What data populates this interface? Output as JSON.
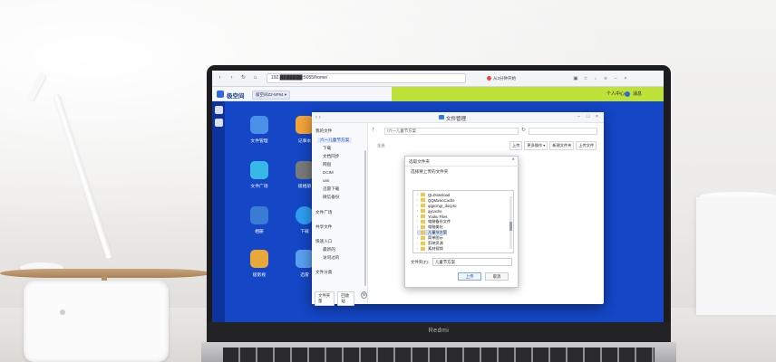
{
  "browser": {
    "url": "192.███████:5055/home/",
    "search_hint": "从3分钟开始",
    "nav_icons": [
      "back-icon",
      "forward-icon",
      "refresh-icon",
      "home-icon"
    ]
  },
  "app": {
    "name": "极空间",
    "device_tag": "极空间Z2-5F94 ▾",
    "header_right": [
      "个人中心",
      "消息"
    ],
    "accent_color": "#bfe23a",
    "brand_color": "#2d6be0"
  },
  "desktop": {
    "icons": [
      {
        "label": "文件管理",
        "color": "#4a8fe8"
      },
      {
        "label": "记事本",
        "color": "#f2a33a"
      },
      {
        "label": "文件广场",
        "color": "#38b8e8"
      },
      {
        "label": "极相册",
        "color": "#7a7a7a"
      },
      {
        "label": "相册",
        "color": "#3a7bd5"
      },
      {
        "label": "下载",
        "color": "#2f9df0"
      },
      {
        "label": "极影视",
        "color": "#e8a93a"
      },
      {
        "label": "迅雷",
        "color": "#5aa0f0"
      }
    ]
  },
  "file_manager": {
    "title": "文件管理",
    "sidebar": {
      "groups": [
        {
          "label": "我的文件"
        },
        {
          "label": "六一儿童节方案",
          "selected": true
        },
        {
          "label": "下载"
        },
        {
          "label": "文档同步"
        },
        {
          "label": "网盘"
        },
        {
          "label": "DCIM"
        },
        {
          "label": "umi"
        },
        {
          "label": "迅雷下载"
        },
        {
          "label": "微信备份"
        },
        {
          "label": "文件广场"
        },
        {
          "label": "共享文件"
        },
        {
          "label": "快速入口"
        },
        {
          "label": "最新的"
        },
        {
          "label": "访问过的"
        },
        {
          "label": "文件分类"
        }
      ],
      "bottom_buttons": [
        "文件夹量",
        "回收站"
      ]
    },
    "path": "/六一儿童节方案",
    "toolbar": {
      "select_all": "全选",
      "buttons": [
        "上传",
        "更多操作 ▾",
        "新建文件夹",
        "上传文件"
      ]
    }
  },
  "dialog": {
    "title": "选取文件夹",
    "prompt": "选择要上传的文件夹",
    "tree": [
      {
        "label": "QLDownload"
      },
      {
        "label": "QQMusicCache"
      },
      {
        "label": "qqpcmgr_docpro"
      },
      {
        "label": "qycache"
      },
      {
        "label": "Youku Files"
      },
      {
        "label": "电脑备份文件"
      },
      {
        "label": "电脑美化"
      },
      {
        "label": "儿童节方案",
        "selected": true
      },
      {
        "label": "简单图示"
      },
      {
        "label": "剪映资源"
      },
      {
        "label": "素材视频"
      }
    ],
    "name_label": "文件夹(F):",
    "name_value": "儿童节方案",
    "ok_label": "上传",
    "cancel_label": "取消"
  },
  "laptop": {
    "brand": "Redmi"
  }
}
